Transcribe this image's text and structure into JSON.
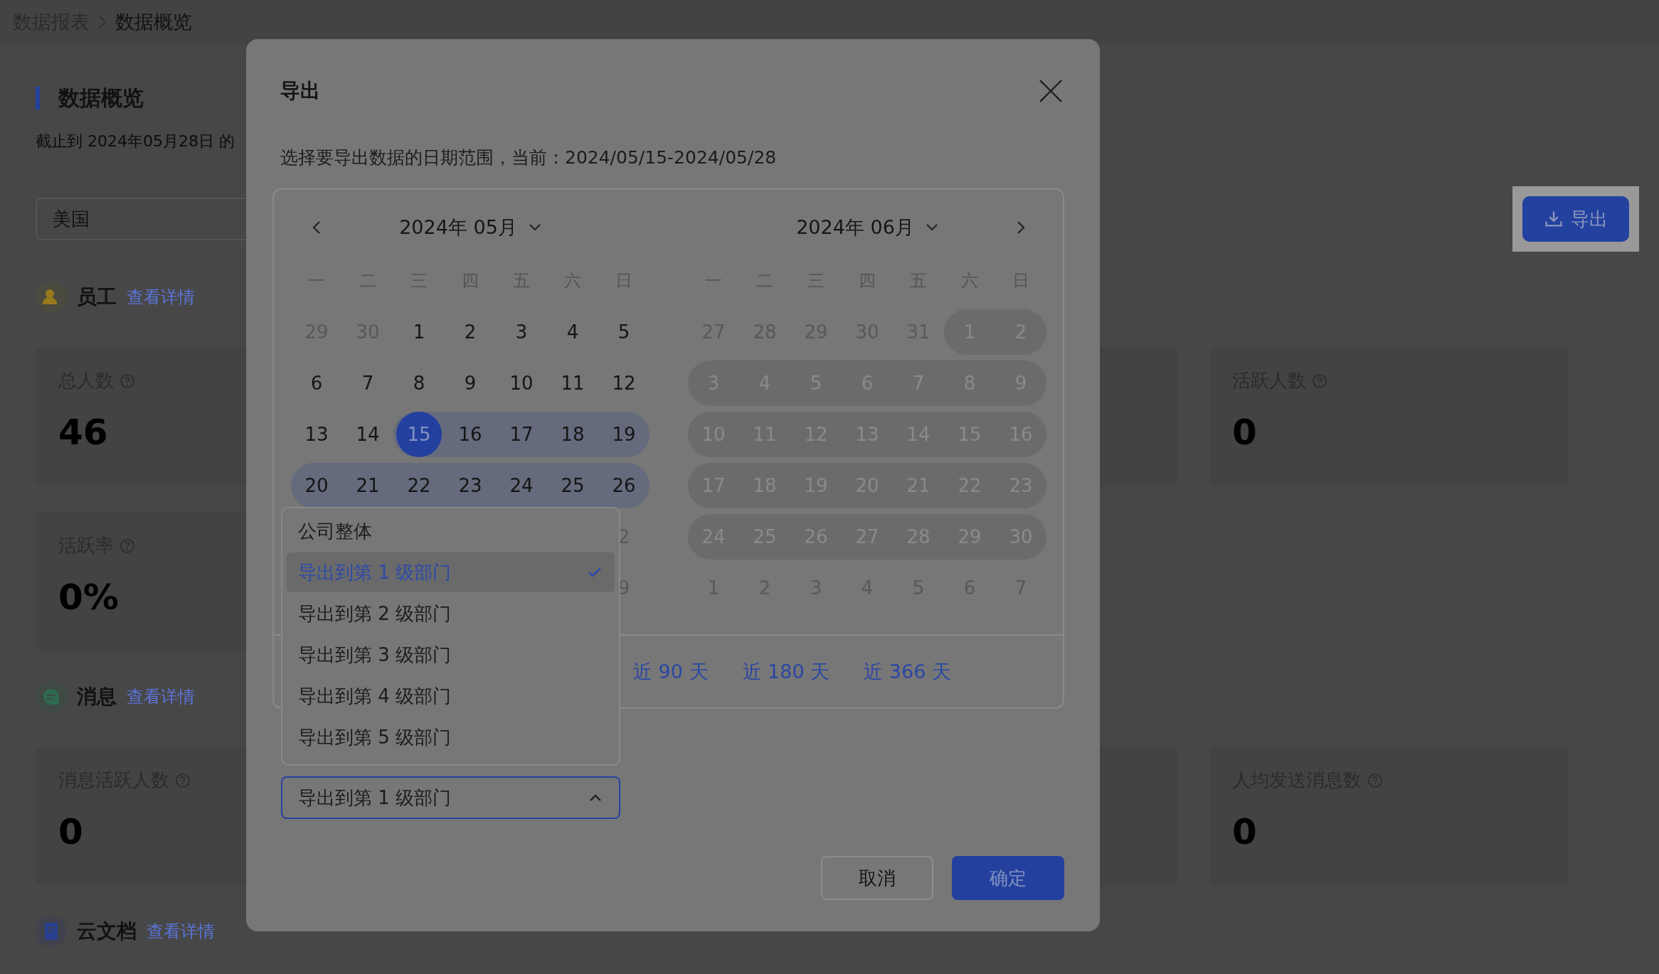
{
  "breadcrumb": [
    {
      "label": "数据报表",
      "selected": false
    },
    {
      "label": "数据概览",
      "selected": true
    }
  ],
  "page": {
    "title": "数据概览",
    "subtitle": "截止到 2024年05月28日 的",
    "region_select": {
      "value": "美国"
    },
    "export_button": {
      "label": "导出"
    }
  },
  "sections": [
    {
      "title": "员工",
      "link": "查看详情",
      "cards": [
        {
          "kind": "stat",
          "label": "总人数",
          "value": "46"
        },
        {
          "kind": "covered"
        },
        {
          "kind": "stat",
          "label": "活跃人数",
          "value": "0"
        },
        {
          "kind": "stat",
          "label": "活跃率",
          "value": "0%"
        }
      ]
    },
    {
      "title": "消息",
      "link": "查看详情",
      "cards": [
        {
          "kind": "stat",
          "label": "消息活跃人数",
          "value": "0"
        },
        {
          "kind": "covered"
        },
        {
          "kind": "stat",
          "label": "人均发送消息数",
          "value": "0"
        }
      ]
    },
    {
      "title": "云文档",
      "link": "查看详情"
    }
  ],
  "dialog": {
    "title": "导出",
    "description": "选择要导出数据的日期范围，当前：2024/05/15-2024/05/28",
    "months": [
      {
        "title": "2024年 05月",
        "weekdays": [
          "一",
          "二",
          "三",
          "四",
          "五",
          "六",
          "日"
        ],
        "rows": [
          [
            {
              "d": "29",
              "kind": "other"
            },
            {
              "d": "30",
              "kind": "other"
            },
            {
              "d": "1",
              "kind": "normal"
            },
            {
              "d": "2",
              "kind": "normal"
            },
            {
              "d": "3",
              "kind": "normal"
            },
            {
              "d": "4",
              "kind": "normal"
            },
            {
              "d": "5",
              "kind": "normal"
            }
          ],
          [
            {
              "d": "6",
              "kind": "normal"
            },
            {
              "d": "7",
              "kind": "normal"
            },
            {
              "d": "8",
              "kind": "normal"
            },
            {
              "d": "9",
              "kind": "normal"
            },
            {
              "d": "10",
              "kind": "normal"
            },
            {
              "d": "11",
              "kind": "normal"
            },
            {
              "d": "12",
              "kind": "normal"
            }
          ],
          [
            {
              "d": "13",
              "kind": "normal"
            },
            {
              "d": "14",
              "kind": "normal"
            },
            {
              "d": "15",
              "kind": "start"
            },
            {
              "d": "16",
              "kind": "range"
            },
            {
              "d": "17",
              "kind": "range"
            },
            {
              "d": "18",
              "kind": "range"
            },
            {
              "d": "19",
              "kind": "range"
            }
          ],
          [
            {
              "d": "20",
              "kind": "range"
            },
            {
              "d": "21",
              "kind": "range"
            },
            {
              "d": "22",
              "kind": "range"
            },
            {
              "d": "23",
              "kind": "range"
            },
            {
              "d": "24",
              "kind": "range"
            },
            {
              "d": "25",
              "kind": "range"
            },
            {
              "d": "26",
              "kind": "range"
            }
          ],
          [
            {
              "d": "2",
              "kind": "other"
            }
          ],
          [
            {
              "d": "9",
              "kind": "other"
            }
          ]
        ]
      },
      {
        "title": "2024年 06月",
        "weekdays": [
          "一",
          "二",
          "三",
          "四",
          "五",
          "六",
          "日"
        ],
        "rows": [
          [
            {
              "d": "27",
              "kind": "other"
            },
            {
              "d": "28",
              "kind": "other"
            },
            {
              "d": "29",
              "kind": "other"
            },
            {
              "d": "30",
              "kind": "other"
            },
            {
              "d": "31",
              "kind": "other"
            },
            {
              "d": "1",
              "kind": "disabled"
            },
            {
              "d": "2",
              "kind": "disabled"
            }
          ],
          [
            {
              "d": "3",
              "kind": "disabled"
            },
            {
              "d": "4",
              "kind": "disabled"
            },
            {
              "d": "5",
              "kind": "disabled"
            },
            {
              "d": "6",
              "kind": "disabled"
            },
            {
              "d": "7",
              "kind": "disabled"
            },
            {
              "d": "8",
              "kind": "disabled"
            },
            {
              "d": "9",
              "kind": "disabled"
            }
          ],
          [
            {
              "d": "10",
              "kind": "disabled"
            },
            {
              "d": "11",
              "kind": "disabled"
            },
            {
              "d": "12",
              "kind": "disabled"
            },
            {
              "d": "13",
              "kind": "disabled"
            },
            {
              "d": "14",
              "kind": "disabled"
            },
            {
              "d": "15",
              "kind": "disabled"
            },
            {
              "d": "16",
              "kind": "disabled"
            }
          ],
          [
            {
              "d": "17",
              "kind": "disabled"
            },
            {
              "d": "18",
              "kind": "disabled"
            },
            {
              "d": "19",
              "kind": "disabled"
            },
            {
              "d": "20",
              "kind": "disabled"
            },
            {
              "d": "21",
              "kind": "disabled"
            },
            {
              "d": "22",
              "kind": "disabled"
            },
            {
              "d": "23",
              "kind": "disabled"
            }
          ],
          [
            {
              "d": "24",
              "kind": "disabled"
            },
            {
              "d": "25",
              "kind": "disabled"
            },
            {
              "d": "26",
              "kind": "disabled"
            },
            {
              "d": "27",
              "kind": "disabled"
            },
            {
              "d": "28",
              "kind": "disabled"
            },
            {
              "d": "29",
              "kind": "disabled"
            },
            {
              "d": "30",
              "kind": "disabled"
            }
          ],
          [
            {
              "d": "1",
              "kind": "other"
            },
            {
              "d": "2",
              "kind": "other"
            },
            {
              "d": "3",
              "kind": "other"
            },
            {
              "d": "4",
              "kind": "other"
            },
            {
              "d": "5",
              "kind": "other"
            },
            {
              "d": "6",
              "kind": "other"
            },
            {
              "d": "7",
              "kind": "other"
            }
          ]
        ]
      }
    ],
    "shortcuts": [
      "近 90 天",
      "近 180 天",
      "近 366 天"
    ],
    "level_options": [
      {
        "label": "公司整体",
        "selected": false
      },
      {
        "label": "导出到第 1 级部门",
        "selected": true
      },
      {
        "label": "导出到第 2 级部门",
        "selected": false
      },
      {
        "label": "导出到第 3 级部门",
        "selected": false
      },
      {
        "label": "导出到第 4 级部门",
        "selected": false
      },
      {
        "label": "导出到第 5 级部门",
        "selected": false
      }
    ],
    "level_select": {
      "value": "导出到第 1 级部门",
      "expanded": true
    },
    "buttons": [
      {
        "label": "取消",
        "kind": "secondary"
      },
      {
        "label": "确定",
        "kind": "primary"
      }
    ]
  }
}
